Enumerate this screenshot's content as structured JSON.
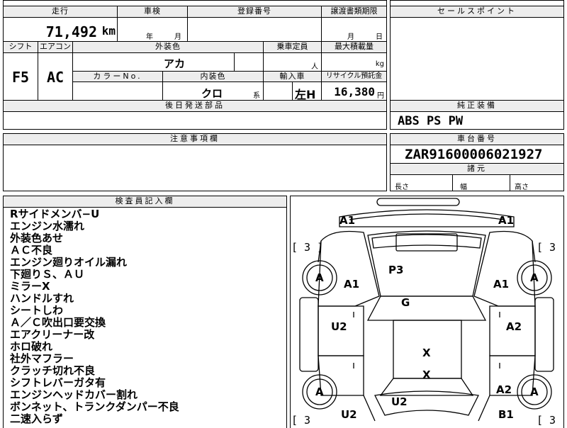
{
  "top": {
    "mileage_header": "走行",
    "shaken_header": "車検",
    "registration_header": "登録番号",
    "transfer_deadline_header": "譲渡書類期限",
    "mileage_value": "71,492",
    "mileage_unit": "km",
    "shaken_year_label": "年",
    "shaken_month_label": "月",
    "transfer_month_label": "月",
    "transfer_day_label": "日"
  },
  "spec": {
    "shift_header": "シフト",
    "aircon_header": "エアコン",
    "exterior_color_header": "外装色",
    "capacity_header": "乗車定員",
    "max_load_header": "最大積載量",
    "shift_value": "F5",
    "aircon_value": "AC",
    "exterior_color_value": "アカ",
    "capacity_unit": "人",
    "load_unit": "kg",
    "color_no_header": "カラーNo.",
    "interior_color_header": "内装色",
    "import_header": "輸入車",
    "recycle_header": "リサイクル預託金",
    "interior_color_value": "クロ",
    "interior_color_suffix": "系",
    "import_value": "左H",
    "recycle_value": "16,380",
    "recycle_unit": "円",
    "parts_header": "後日発送部品"
  },
  "sales_point": {
    "header": "セールスポイント"
  },
  "genuine_equipment": {
    "header": "純正装備",
    "value": "ABS PS PW"
  },
  "caution": {
    "header": "注意事項欄"
  },
  "chassis": {
    "header": "車台番号",
    "value": "ZAR91600006021927"
  },
  "dimensions": {
    "header": "諸元",
    "length": "長さ",
    "width": "幅",
    "height": "高さ"
  },
  "inspector": {
    "header": "検査員記入欄",
    "lines": [
      "Rサイドメンバ−U",
      "エンジン水濡れ",
      "外装色あせ",
      "ＡＣ不良",
      "エンジン廻りオイル漏れ",
      "下廻りＳ、ＡＵ",
      "ミラーX",
      "ハンドルすれ",
      "シートしわ",
      "Ａ／Ｃ吹出口要交換",
      "エアクリーナー改",
      "ホロ破れ",
      "社外マフラー",
      "クラッチ切れ不良",
      "シフトレバーガタ有",
      "エンジンヘッドカバー割れ",
      "ボンネット、トランクダンパー不良",
      "二速入らず"
    ]
  },
  "diagram": {
    "marks": {
      "front_left_corner": "A1",
      "front_right_corner": "A1",
      "left_front_fender": "A1",
      "right_front_fender": "A1",
      "hood": "P3",
      "roof": "G",
      "left_front_door": "U2",
      "right_front_door": "A2",
      "left_front_wheel": "A",
      "right_front_wheel": "A",
      "left_rear_wheel": "A",
      "right_rear_wheel": "A",
      "rear_glass": "X",
      "trunk": "X",
      "rear_center": "U2",
      "left_rear_quarter": "U2",
      "right_rear_quarter": "A2",
      "right_rear_corner": "B1",
      "tire_tl": "[ 3 ]",
      "tire_tr": "[ 3 ]",
      "tire_bl": "[ 3",
      "tire_br": "[ 3 ]"
    }
  }
}
